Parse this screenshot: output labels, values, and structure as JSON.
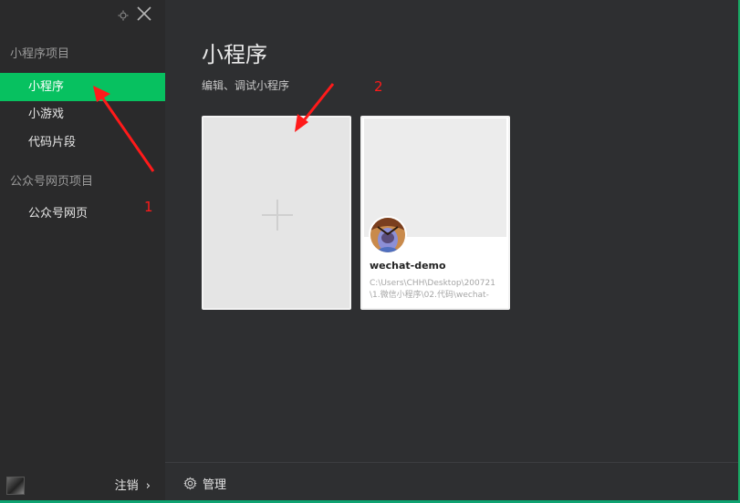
{
  "sidebar": {
    "groups": [
      {
        "title": "小程序项目",
        "items": [
          "小程序",
          "小游戏",
          "代码片段"
        ]
      },
      {
        "title": "公众号网页项目",
        "items": [
          "公众号网页"
        ]
      }
    ],
    "logout_label": "注销",
    "logout_chevron": "›"
  },
  "main": {
    "title": "小程序",
    "subtitle": "编辑、调试小程序",
    "project": {
      "name": "wechat-demo",
      "path": "C:\\Users\\CHH\\Desktop\\200721\\1.微信小程序\\02.代码\\wechat-"
    },
    "manage_label": "管理"
  },
  "annotations": [
    "1",
    "2"
  ],
  "colors": {
    "accent": "#07c160",
    "annotation": "#ff1a1a",
    "sidebar_bg": "#2a2a2b",
    "main_bg": "#2e2f31"
  },
  "icons": [
    "settings-small-icon",
    "close-icon",
    "plus-icon",
    "gear-icon",
    "chevron-right-icon"
  ]
}
